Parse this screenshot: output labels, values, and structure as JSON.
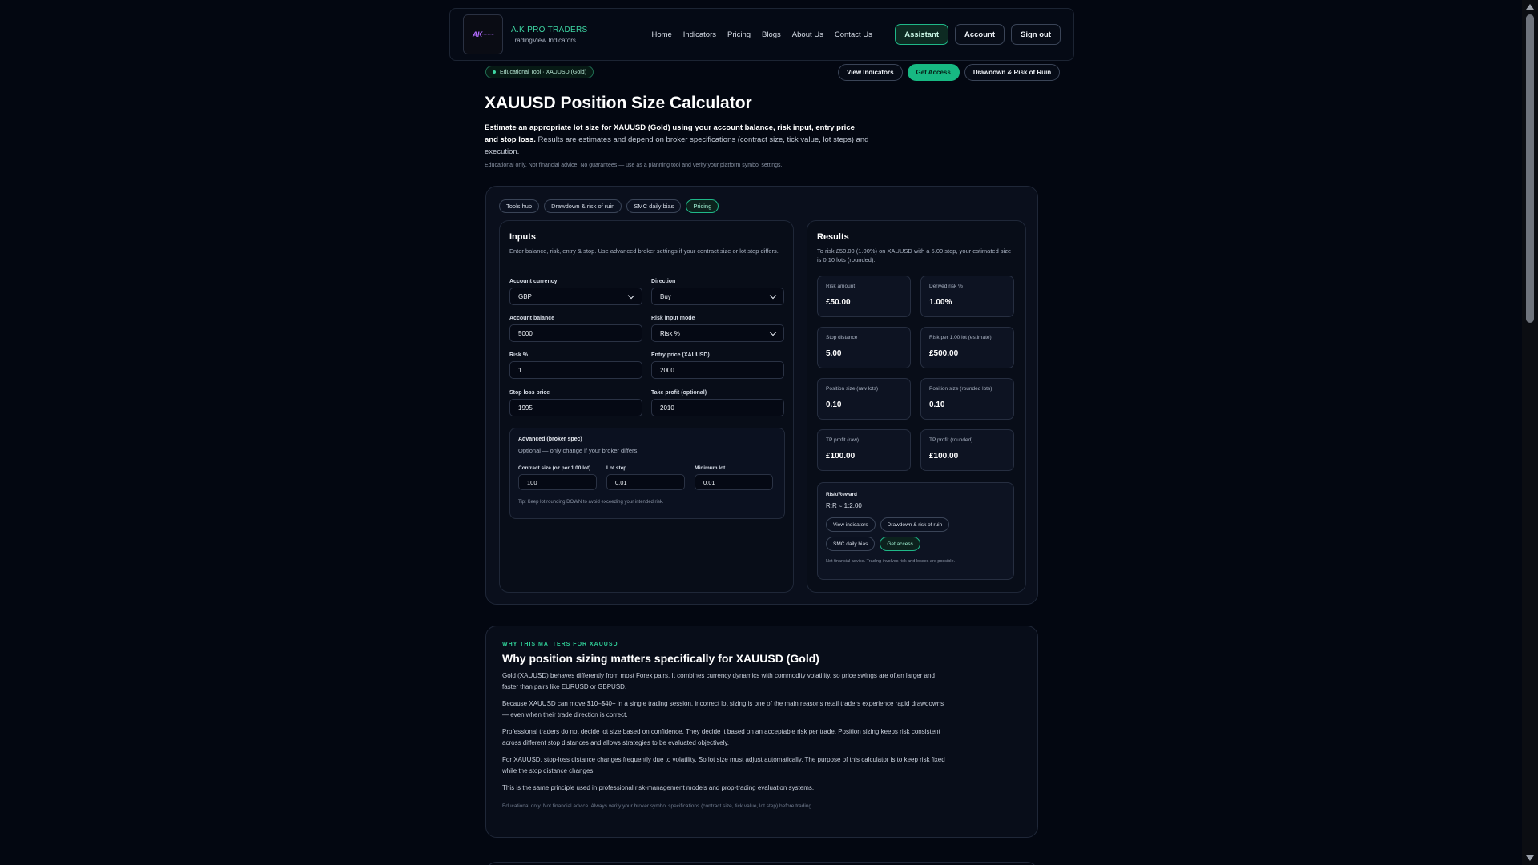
{
  "header": {
    "brand_name": "A.K PRO TRADERS",
    "brand_sub": "TradingView Indicators",
    "nav": [
      "Home",
      "Indicators",
      "Pricing",
      "Blogs",
      "About Us",
      "Contact Us"
    ],
    "assistant_label": "Assistant",
    "account_label": "Account",
    "signout_label": "Sign out"
  },
  "badge": "Educational Tool · XAUUSD (Gold)",
  "subnav": {
    "view_indicators": "View Indicators",
    "get_access": "Get Access",
    "drawdown": "Drawdown & Risk of Ruin"
  },
  "hero": {
    "title": "XAUUSD Position Size Calculator",
    "desc_bold": "Estimate an appropriate lot size for XAUUSD (Gold) using your account balance, risk input, entry price and stop loss.",
    "desc_rest": " Results are estimates and depend on broker specifications (contract size, tick value, lot steps) and execution.",
    "note": "Educational only. Not financial advice. No guarantees — use as a planning tool and verify your platform symbol settings."
  },
  "chips": [
    "Tools hub",
    "Drawdown & risk of ruin",
    "SMC daily bias",
    "Pricing"
  ],
  "inputs": {
    "title": "Inputs",
    "desc": "Enter balance, risk, entry & stop. Use advanced broker settings if your contract size or lot step differs.",
    "account_currency_label": "Account currency",
    "account_currency": "GBP",
    "direction_label": "Direction",
    "direction": "Buy",
    "account_balance_label": "Account balance",
    "account_balance": "5000",
    "risk_mode_label": "Risk input mode",
    "risk_mode": "Risk %",
    "risk_pct_label": "Risk %",
    "risk_pct": "1",
    "entry_label": "Entry price (XAUUSD)",
    "entry": "2000",
    "stop_label": "Stop loss price",
    "stop": "1995",
    "tp_label": "Take profit (optional)",
    "tp": "2010",
    "advanced": {
      "title": "Advanced (broker spec)",
      "sub": "Optional — only change if your broker differs.",
      "contract_label": "Contract size (oz per 1.00 lot)",
      "contract": "100",
      "lot_step_label": "Lot step",
      "lot_step": "0.01",
      "min_lot_label": "Minimum lot",
      "min_lot": "0.01",
      "tip": "Tip: Keep lot rounding DOWN to avoid exceeding your intended risk."
    }
  },
  "results": {
    "title": "Results",
    "desc": "To risk £50.00 (1.00%) on XAUUSD with a 5.00 stop, your estimated size is 0.10 lots (rounded).",
    "stats": [
      {
        "label": "Risk amount",
        "value": "£50.00"
      },
      {
        "label": "Derived risk %",
        "value": "1.00%"
      },
      {
        "label": "Stop distance",
        "value": "5.00"
      },
      {
        "label": "Risk per 1.00 lot (estimate)",
        "value": "£500.00"
      },
      {
        "label": "Position size (raw lots)",
        "value": "0.10"
      },
      {
        "label": "Position size (rounded lots)",
        "value": "0.10"
      },
      {
        "label": "TP profit (raw)",
        "value": "£100.00"
      },
      {
        "label": "TP profit (rounded)",
        "value": "£100.00"
      }
    ],
    "rr_label": "Risk/Reward",
    "rr_value": "R:R ≈ 1:2.00",
    "links": [
      "View indicators",
      "Drawdown & risk of ruin",
      "SMC daily bias",
      "Get access"
    ],
    "disclaimer": "Not financial advice. Trading involves risk and losses are possible."
  },
  "why": {
    "eyebrow": "WHY THIS MATTERS FOR XAUUSD",
    "title": "Why position sizing matters specifically for XAUUSD (Gold)",
    "paragraphs": [
      "Gold (XAUUSD) behaves differently from most Forex pairs. It combines currency dynamics with commodity volatility, so price swings are often larger and faster than pairs like EURUSD or GBPUSD.",
      "Because XAUUSD can move $10–$40+ in a single trading session, incorrect lot sizing is one of the main reasons retail traders experience rapid drawdowns — even when their trade direction is correct.",
      "Professional traders do not decide lot size based on confidence. They decide it based on an acceptable risk per trade. Position sizing keeps risk consistent across different stop distances and allows strategies to be evaluated objectively.",
      "For XAUUSD, stop-loss distance changes frequently due to volatility. So lot size must adjust automatically. The purpose of this calculator is to keep risk fixed while the stop distance changes.",
      "This is the same principle used in professional risk-management models and prop-trading evaluation systems."
    ],
    "note": "Educational only. Not financial advice. Always verify your broker symbol specifications (contract size, tick value, lot step) before trading."
  },
  "icons": {
    "logo": "brand-logo-icon",
    "select": "chevron-down-icon",
    "badge_dot": "status-dot-icon"
  },
  "colors": {
    "accent": "#17b882",
    "background": "#030711",
    "card": "#0a0f1c"
  }
}
